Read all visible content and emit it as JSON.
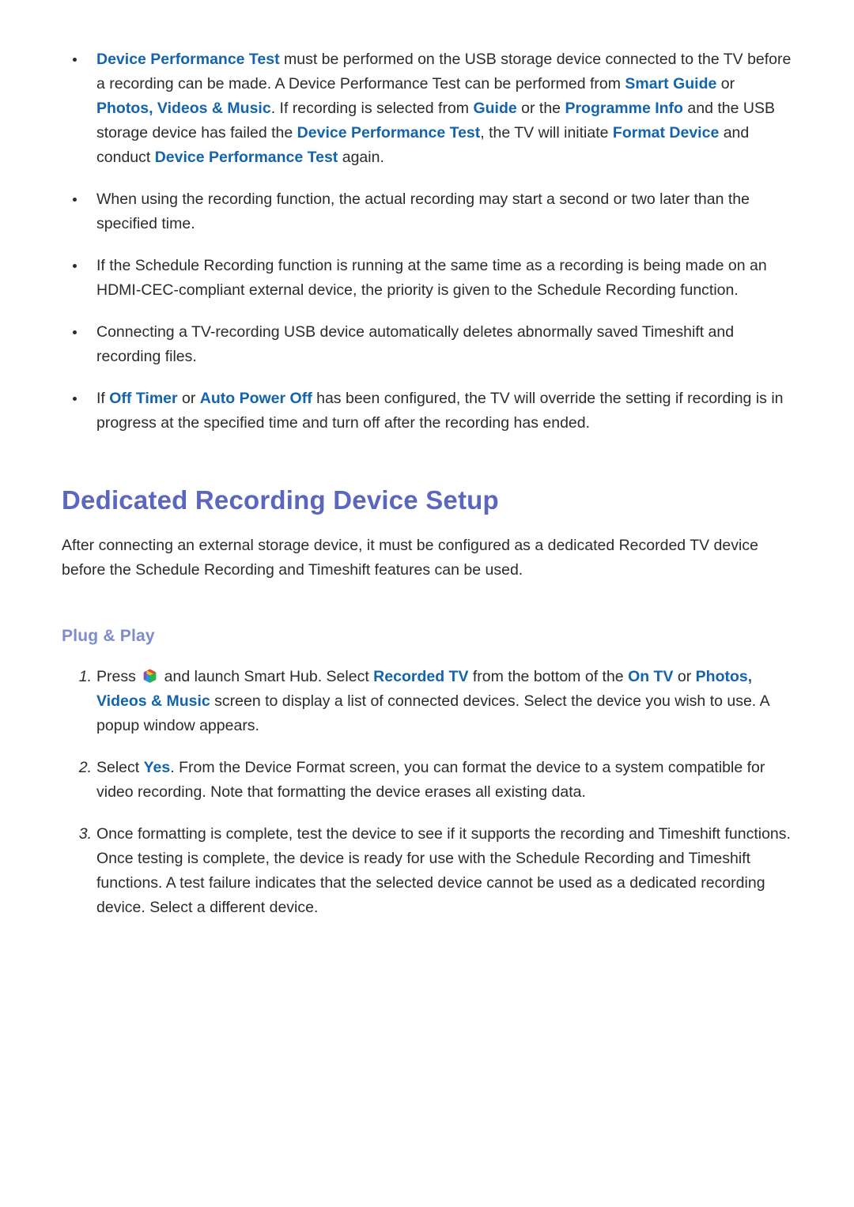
{
  "page": {
    "background": "#ffffff",
    "text_color": "#2b2b2b",
    "term_color": "#1364ac",
    "heading_color": "#5b67be",
    "subheading_color": "#7f8bcd"
  },
  "notes": {
    "items": [
      {
        "id": "note-device-performance-test",
        "parts": [
          {
            "text": "Device Performance Test",
            "style": "term"
          },
          {
            "text": " must be performed on the USB storage device connected to the TV before a recording can be made. A Device Performance Test can be performed from ",
            "style": "plain"
          },
          {
            "text": "Smart Guide",
            "style": "term"
          },
          {
            "text": " or ",
            "style": "plain"
          },
          {
            "text": "Photos, Videos & Music",
            "style": "term"
          },
          {
            "text": ". If recording is selected from ",
            "style": "plain"
          },
          {
            "text": "Guide",
            "style": "term"
          },
          {
            "text": " or the ",
            "style": "plain"
          },
          {
            "text": "Programme Info",
            "style": "term"
          },
          {
            "text": " and the USB storage device has failed the ",
            "style": "plain"
          },
          {
            "text": "Device Performance Test",
            "style": "term"
          },
          {
            "text": ", the TV will initiate ",
            "style": "plain"
          },
          {
            "text": "Format Device",
            "style": "term"
          },
          {
            "text": " and conduct ",
            "style": "plain"
          },
          {
            "text": "Device Performance Test",
            "style": "term"
          },
          {
            "text": " again.",
            "style": "plain"
          }
        ]
      },
      {
        "id": "note-recording-delay",
        "parts": [
          {
            "text": "When using the recording function, the actual recording may start a second or two later than the specified time.",
            "style": "plain"
          }
        ]
      },
      {
        "id": "note-hdmi-cec-priority",
        "parts": [
          {
            "text": "If the Schedule Recording function is running at the same time as a recording is being made on an HDMI-CEC-compliant external device, the priority is given to the Schedule Recording function.",
            "style": "plain"
          }
        ]
      },
      {
        "id": "note-usb-deletes-abnormal-files",
        "parts": [
          {
            "text": "Connecting a TV-recording USB device automatically deletes abnormally saved Timeshift and recording files.",
            "style": "plain"
          }
        ]
      },
      {
        "id": "note-off-timer-override",
        "parts": [
          {
            "text": "If ",
            "style": "plain"
          },
          {
            "text": "Off Timer",
            "style": "term"
          },
          {
            "text": " or ",
            "style": "plain"
          },
          {
            "text": "Auto Power Off",
            "style": "term"
          },
          {
            "text": " has been configured, the TV will override the setting if recording is in progress at the specified time and turn off after the recording has ended.",
            "style": "plain"
          }
        ]
      }
    ]
  },
  "section": {
    "heading": "Dedicated Recording Device Setup",
    "intro": "After connecting an external storage device, it must be configured as a dedicated Recorded TV device before the Schedule Recording and Timeshift features can be used.",
    "subheading": "Plug & Play",
    "steps": [
      {
        "marker": "1.",
        "parts": [
          {
            "text": "Press ",
            "style": "plain"
          },
          {
            "text": "",
            "style": "icon",
            "icon": "smart-hub-cube-icon"
          },
          {
            "text": " and launch Smart Hub. Select ",
            "style": "plain"
          },
          {
            "text": "Recorded TV",
            "style": "term"
          },
          {
            "text": " from the bottom of the ",
            "style": "plain"
          },
          {
            "text": "On TV",
            "style": "term"
          },
          {
            "text": " or ",
            "style": "plain"
          },
          {
            "text": "Photos, Videos & Music",
            "style": "term"
          },
          {
            "text": " screen to display a list of connected devices. Select the device you wish to use. A popup window appears.",
            "style": "plain"
          }
        ]
      },
      {
        "marker": "2.",
        "parts": [
          {
            "text": "Select ",
            "style": "plain"
          },
          {
            "text": "Yes",
            "style": "term"
          },
          {
            "text": ". From the Device Format screen, you can format the device to a system compatible for video recording. Note that formatting the device erases all existing data.",
            "style": "plain"
          }
        ]
      },
      {
        "marker": "3.",
        "parts": [
          {
            "text": "Once formatting is complete, test the device to see if it supports the recording and Timeshift functions. Once testing is complete, the device is ready for use with the Schedule Recording and Timeshift functions. A test failure indicates that the selected device cannot be used as a dedicated recording device. Select a different device.",
            "style": "plain"
          }
        ]
      }
    ]
  }
}
